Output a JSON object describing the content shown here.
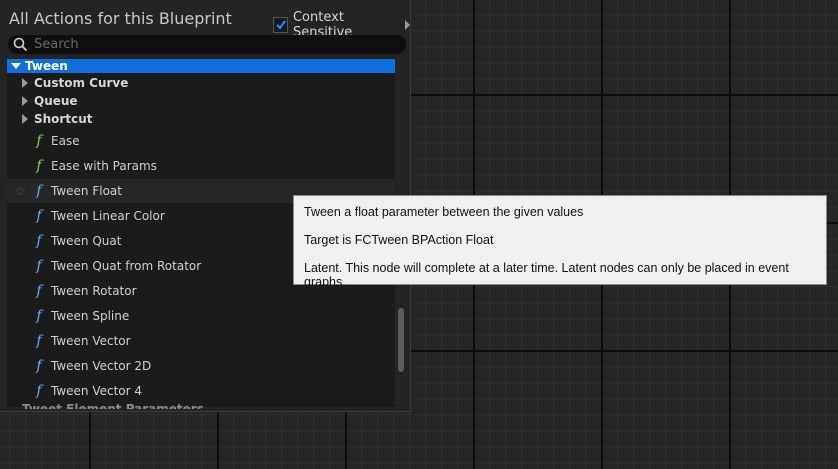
{
  "header": {
    "title": "All Actions for this Blueprint",
    "context_label": "Context Sensitive",
    "context_checked": true
  },
  "search": {
    "placeholder": "Search",
    "value": ""
  },
  "tree": {
    "selected_category": "Tween",
    "subcategories": [
      "Custom Curve",
      "Queue",
      "Shortcut"
    ],
    "items": [
      {
        "label": "Ease",
        "icon": "function-icon",
        "color": "#8ad14a"
      },
      {
        "label": "Ease with Params",
        "icon": "function-icon",
        "color": "#8ad14a"
      },
      {
        "label": "Tween Float",
        "icon": "function-icon",
        "color": "#5fb0ff"
      },
      {
        "label": "Tween Linear Color",
        "icon": "function-icon",
        "color": "#5fb0ff"
      },
      {
        "label": "Tween Quat",
        "icon": "function-icon",
        "color": "#5fb0ff"
      },
      {
        "label": "Tween Quat from Rotator",
        "icon": "function-icon",
        "color": "#5fb0ff"
      },
      {
        "label": "Tween Rotator",
        "icon": "function-icon",
        "color": "#5fb0ff"
      },
      {
        "label": "Tween Spline",
        "icon": "function-icon",
        "color": "#5fb0ff"
      },
      {
        "label": "Tween Vector",
        "icon": "function-icon",
        "color": "#5fb0ff"
      },
      {
        "label": "Tween Vector 2D",
        "icon": "function-icon",
        "color": "#5fb0ff"
      },
      {
        "label": "Tween Vector 4",
        "icon": "function-icon",
        "color": "#5fb0ff"
      }
    ],
    "next_category_partial": "Tweet Element Parameters"
  },
  "tooltip": {
    "line1": "Tween a float parameter between the given values",
    "line2": "Target is FCTween BPAction Float",
    "line3": "Latent. This node will complete at a later time. Latent nodes can only be placed in event graphs."
  },
  "colors": {
    "selection": "#0f6fdc",
    "accent_check": "#1e90ff"
  }
}
